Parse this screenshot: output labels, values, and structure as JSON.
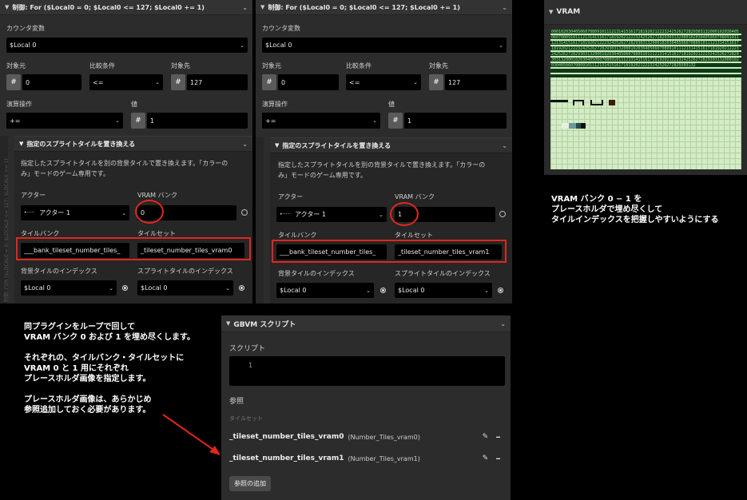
{
  "panel1": {
    "header": "制御: For ($Local0 = 0; $Local0 <= 127; $Local0 += 1)",
    "counter_label": "カウンタ変数",
    "counter_value": "$Local 0",
    "target_from_label": "対象元",
    "compare_label": "比較条件",
    "target_to_label": "対象先",
    "from_value": "0",
    "compare_value": "<=",
    "to_value": "127",
    "op_label": "演算操作",
    "val_label": "値",
    "op_value": "+=",
    "val_value": "1",
    "hash": "#",
    "gutter_text": "制御: FOR ($LOCAL0 = 0; $LOCAL0 <= 127; $LOCAL0 += 1)",
    "sub": {
      "header": "指定のスプライトタイルを置き換える",
      "desc1": "指定したスプライトタイルを別の背景タイルで置き換えます。「カラーの",
      "desc2": "み」モードのゲーム専用です。",
      "actor_label": "アクター",
      "vram_label": "VRAM バンク",
      "actor_value": "アクター 1",
      "actor_icon": "•·····",
      "vram_value": "0",
      "tilebank_label": "タイルバンク",
      "tileset_label": "タイルセット",
      "tilebank_value": "___bank_tileset_number_tiles_",
      "tileset_value": "_tileset_number_tiles_vram0",
      "bg_index_label": "背景タイルのインデックス",
      "sprite_index_label": "スプライトタイルのインデックス",
      "bg_index_value": "$Local 0",
      "sprite_index_value": "$Local 0"
    }
  },
  "panel2": {
    "header": "制御: For ($Local0 = 0; $Local0 <= 127; $Local0 += 1)",
    "counter_label": "カウンタ変数",
    "counter_value": "$Local 0",
    "target_from_label": "対象元",
    "compare_label": "比較条件",
    "target_to_label": "対象先",
    "from_value": "0",
    "compare_value": "<=",
    "to_value": "127",
    "op_label": "演算操作",
    "val_label": "値",
    "op_value": "+=",
    "val_value": "1",
    "hash": "#",
    "sub": {
      "header": "指定のスプライトタイルを置き換える",
      "desc1": "指定したスプライトタイルを別の背景タイルで置き換えます。「カラーの",
      "desc2": "み」モードのゲーム専用です。",
      "actor_label": "アクター",
      "vram_label": "VRAM バンク",
      "actor_value": "アクター 1",
      "actor_icon": "•·····",
      "vram_value": "1",
      "tilebank_label": "タイルバンク",
      "tileset_label": "タイルセット",
      "tilebank_value": "___bank_tileset_number_tiles_",
      "tileset_value": "_tileset_number_tiles_vram1",
      "bg_index_label": "背景タイルのインデックス",
      "sprite_index_label": "スプライトタイルのインデックス",
      "bg_index_value": "$Local 0",
      "sprite_index_value": "$Local 0"
    }
  },
  "vram": {
    "title": "VRAM",
    "row_text": "000102030405060708091011121314151617181920212223242526272829303132"
  },
  "note_right": [
    "VRAM バンク 0 − 1 を",
    "プレースホルダで埋め尽くして",
    "タイルインデックスを把握しやすいようにする"
  ],
  "note_left": [
    "同プラグインをループで回して",
    "VRAM バンク 0 および 1 を埋め尽くします。",
    "",
    "それぞれの、タイルバンク・タイルセットに",
    "VRAM 0 と 1 用にそれぞれ",
    "プレースホルダ画像を指定します。",
    "",
    "プレースホルダ画像は、あらかじめ",
    "参照追加しておく必要があります。"
  ],
  "gbvm": {
    "header": "GBVM スクリプト",
    "script_label": "スクリプト",
    "line_number": "1",
    "refs_label": "参照",
    "tileset_group_label": "タイルセット",
    "refs": [
      {
        "name": "_tileset_number_tiles_vram0",
        "detail": "(Number_Tiles_vram0)"
      },
      {
        "name": "_tileset_number_tiles_vram1",
        "detail": "(Number_Tiles_vram1)"
      }
    ],
    "add_ref_button": "参照の追加"
  },
  "icons": {
    "triangle": "▼",
    "chevron": "⌄",
    "dropdown": "⌄",
    "pencil": "✎",
    "minus": "━"
  }
}
